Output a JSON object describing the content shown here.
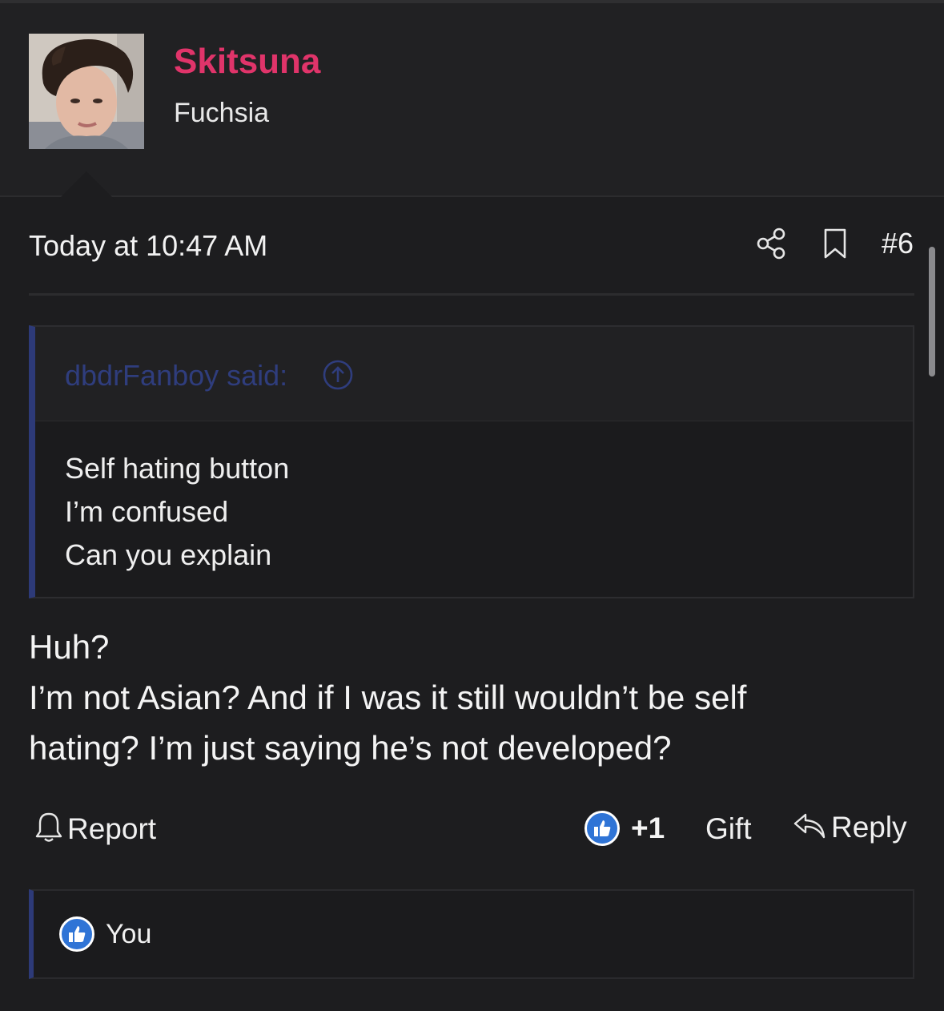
{
  "user": {
    "name": "Skitsuna",
    "title": "Fuchsia"
  },
  "message": {
    "date": "Today at 10:47 AM",
    "post_number": "#6",
    "quote": {
      "author_text": "dbdrFanboy said:",
      "lines": [
        "Self hating button",
        "I’m confused",
        "Can you explain"
      ]
    },
    "body_lines": [
      "Huh?",
      "I’m not Asian? And if I was it still wouldn’t be self",
      "hating? I’m just saying he’s not developed?"
    ]
  },
  "actions": {
    "report_label": "Report",
    "reaction_count": "+1",
    "gift_label": "Gift",
    "reply_label": "Reply"
  },
  "reactions": {
    "users": "You"
  },
  "icons": {
    "share": "share-icon",
    "bookmark": "bookmark-icon",
    "jump": "arrow-up-circle-icon",
    "report": "bell-icon",
    "like": "thumbs-up-icon",
    "reply": "reply-arrow-icon"
  },
  "colors": {
    "background": "#1d1d1f",
    "username": "#e0346a",
    "quote_accent": "#2d3a78",
    "like_blue": "#2f74d6"
  }
}
